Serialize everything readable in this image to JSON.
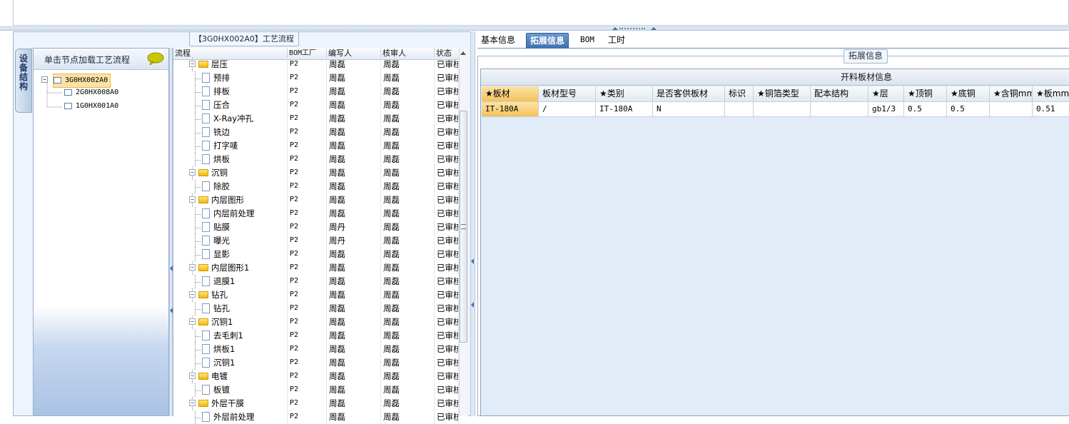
{
  "left_panel": {
    "title": "【3G0HX002A0】工艺流程",
    "vertical_tab": "设备结构",
    "tree_header": "单击节点加载工艺流程",
    "tree_nodes": [
      "3G0HX002A0",
      "2G0HX008A0",
      "1G0HX001A0"
    ]
  },
  "grid": {
    "columns": [
      "流程",
      "BOM工厂",
      "编写人",
      "核审人",
      "状态"
    ],
    "rows": [
      {
        "name": "层压",
        "type": "folder",
        "bom": "P2",
        "writer": "周磊",
        "reviewer": "周磊",
        "status": "已审核"
      },
      {
        "name": "预排",
        "type": "doc",
        "bom": "P2",
        "writer": "周磊",
        "reviewer": "周磊",
        "status": "已审核"
      },
      {
        "name": "排板",
        "type": "doc",
        "bom": "P2",
        "writer": "周磊",
        "reviewer": "周磊",
        "status": "已审核"
      },
      {
        "name": "压合",
        "type": "doc",
        "bom": "P2",
        "writer": "周磊",
        "reviewer": "周磊",
        "status": "已审核"
      },
      {
        "name": "X-Ray冲孔",
        "type": "doc",
        "bom": "P2",
        "writer": "周磊",
        "reviewer": "周磊",
        "status": "已审核"
      },
      {
        "name": "铣边",
        "type": "doc",
        "bom": "P2",
        "writer": "周磊",
        "reviewer": "周磊",
        "status": "已审核"
      },
      {
        "name": "打字唛",
        "type": "doc",
        "bom": "P2",
        "writer": "周磊",
        "reviewer": "周磊",
        "status": "已审核"
      },
      {
        "name": "烘板",
        "type": "doc",
        "bom": "P2",
        "writer": "周磊",
        "reviewer": "周磊",
        "status": "已审核"
      },
      {
        "name": "沉铜",
        "type": "folder",
        "bom": "P2",
        "writer": "周磊",
        "reviewer": "周磊",
        "status": "已审核"
      },
      {
        "name": "除胶",
        "type": "doc",
        "bom": "P2",
        "writer": "周磊",
        "reviewer": "周磊",
        "status": "已审核"
      },
      {
        "name": "内层图形",
        "type": "folder",
        "bom": "P2",
        "writer": "周磊",
        "reviewer": "周磊",
        "status": "已审核"
      },
      {
        "name": "内层前处理",
        "type": "doc",
        "bom": "P2",
        "writer": "周磊",
        "reviewer": "周磊",
        "status": "已审核"
      },
      {
        "name": "贴膜",
        "type": "doc",
        "bom": "P2",
        "writer": "周丹",
        "reviewer": "周磊",
        "status": "已审核"
      },
      {
        "name": "曝光",
        "type": "doc",
        "bom": "P2",
        "writer": "周丹",
        "reviewer": "周磊",
        "status": "已审核"
      },
      {
        "name": "显影",
        "type": "doc",
        "bom": "P2",
        "writer": "周磊",
        "reviewer": "周磊",
        "status": "已审核"
      },
      {
        "name": "内层图形1",
        "type": "folder",
        "bom": "P2",
        "writer": "周磊",
        "reviewer": "周磊",
        "status": "已审核"
      },
      {
        "name": "退膜1",
        "type": "doc",
        "bom": "P2",
        "writer": "周磊",
        "reviewer": "周磊",
        "status": "已审核"
      },
      {
        "name": "钻孔",
        "type": "folder",
        "bom": "P2",
        "writer": "周磊",
        "reviewer": "周磊",
        "status": "已审核"
      },
      {
        "name": "钻孔",
        "type": "doc",
        "bom": "P2",
        "writer": "周磊",
        "reviewer": "周磊",
        "status": "已审核"
      },
      {
        "name": "沉铜1",
        "type": "folder",
        "bom": "P2",
        "writer": "周磊",
        "reviewer": "周磊",
        "status": "已审核"
      },
      {
        "name": "去毛刺1",
        "type": "doc",
        "bom": "P2",
        "writer": "周磊",
        "reviewer": "周磊",
        "status": "已审核"
      },
      {
        "name": "烘板1",
        "type": "doc",
        "bom": "P2",
        "writer": "周磊",
        "reviewer": "周磊",
        "status": "已审核"
      },
      {
        "name": "沉铜1",
        "type": "doc",
        "bom": "P2",
        "writer": "周磊",
        "reviewer": "周磊",
        "status": "已审核"
      },
      {
        "name": "电镀",
        "type": "folder",
        "bom": "P2",
        "writer": "周磊",
        "reviewer": "周磊",
        "status": "已审核"
      },
      {
        "name": "板镀",
        "type": "doc",
        "bom": "P2",
        "writer": "周磊",
        "reviewer": "周磊",
        "status": "已审核"
      },
      {
        "name": "外层干膜",
        "type": "folder",
        "bom": "P2",
        "writer": "周磊",
        "reviewer": "周磊",
        "status": "已审核"
      },
      {
        "name": "外层前处理",
        "type": "doc",
        "bom": "P2",
        "writer": "周磊",
        "reviewer": "周磊",
        "status": "已审核"
      }
    ]
  },
  "right_panel": {
    "tabs": [
      {
        "label": "基本信息",
        "active": false
      },
      {
        "label": "拓展信息",
        "active": true
      },
      {
        "label": "BOM",
        "active": false
      },
      {
        "label": "工时",
        "active": false
      }
    ],
    "group_title": "拓展信息",
    "material_title": "开料板材信息",
    "columns": [
      "★板材",
      "板材型号",
      "★类别",
      "是否客供板材",
      "标识",
      "★铜箔类型",
      "配本结构",
      "★层",
      "★顶铜",
      "★底铜",
      "★含铜mm",
      "★板mm"
    ],
    "row": [
      "IT-180A",
      "/",
      "IT-180A",
      "N",
      "",
      "",
      "",
      "gb1/3",
      "0.5",
      "0.5",
      "",
      "0.51"
    ]
  },
  "colors": {
    "accent": "#3e6fb0",
    "highlight": "#f6c25b",
    "panel_bg": "#eef4fb"
  }
}
